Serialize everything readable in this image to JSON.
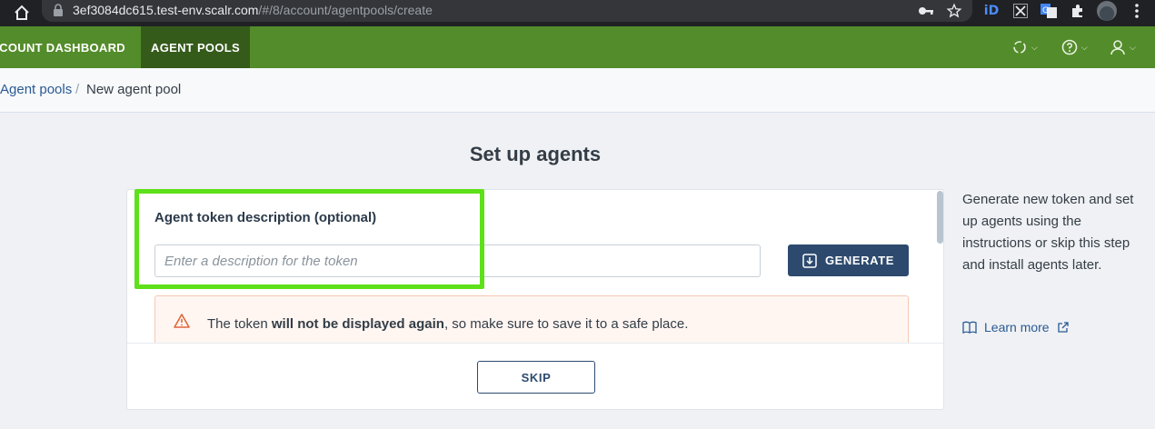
{
  "browser": {
    "url_host": "3ef3084dc615.test-env.scalr.com",
    "url_path": "/#/8/account/agentpools/create"
  },
  "topnav": {
    "items": [
      {
        "label": "ACCOUNT DASHBOARD",
        "active": false
      },
      {
        "label": "AGENT POOLS",
        "active": true
      }
    ],
    "accent": "#538c2a",
    "active_bg": "#355b1b"
  },
  "breadcrumb": {
    "parent": "Agent pools",
    "separator": "/",
    "current": "New agent pool"
  },
  "page": {
    "title": "Set up agents"
  },
  "form": {
    "field_label": "Agent token description (optional)",
    "input_placeholder": "Enter a description for the token",
    "input_value": "",
    "generate_label": "GENERATE",
    "warning_pre": "The token ",
    "warning_bold": "will not be displayed again",
    "warning_post": ", so make sure to save it to a safe place.",
    "skip_label": "SKIP"
  },
  "side_help": {
    "text": "Generate new token and set up agents using the instructions or skip this step and install agents later.",
    "learn_more_label": "Learn more"
  },
  "colors": {
    "primary_button": "#2d4a6e",
    "warning_bg": "#fff6f2",
    "highlight": "#5ee01a"
  },
  "icons": [
    "home-icon",
    "lock-icon",
    "key-icon",
    "star-icon",
    "extension-icon",
    "avatar-icon",
    "menu-dots-icon",
    "refresh-status-icon",
    "help-icon",
    "user-icon",
    "download-icon",
    "warning-icon",
    "book-icon",
    "external-link-icon"
  ]
}
